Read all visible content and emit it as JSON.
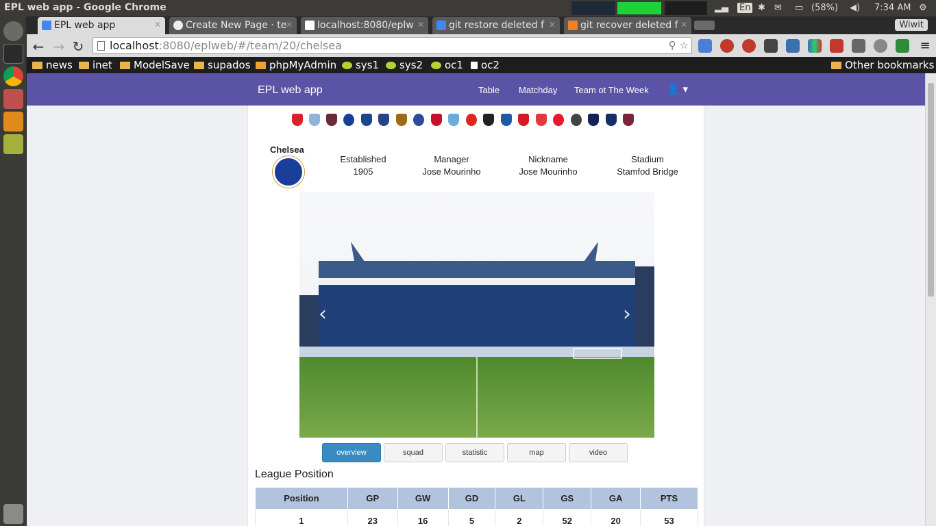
{
  "os": {
    "window_title": "EPL web app - Google Chrome",
    "clock": "7:34 AM",
    "battery": "(58%)",
    "keyboard": "En"
  },
  "browser": {
    "tabs": [
      {
        "label": "EPL web app",
        "icon": "google-icon"
      },
      {
        "label": "Create New Page · te",
        "icon": "github-icon"
      },
      {
        "label": "localhost:8080/eplw",
        "icon": "page-icon"
      },
      {
        "label": "git restore deleted f",
        "icon": "google-icon"
      },
      {
        "label": "git recover deleted f",
        "icon": "stackoverflow-icon"
      }
    ],
    "wiwit": "Wiwit",
    "url_host": "localhost",
    "url_rest": ":8080/eplweb/#/team/20/chelsea",
    "bookmarks": [
      "news",
      "inet",
      "ModelSave",
      "supados",
      "phpMyAdmin",
      "sys1",
      "sys2",
      "oc1",
      "oc2"
    ],
    "other_bookmarks": "Other bookmarks"
  },
  "app": {
    "brand": "EPL web app",
    "nav": [
      "Table",
      "Matchday",
      "Team ot The Week"
    ],
    "team": {
      "name": "Chelsea",
      "fields": [
        {
          "label": "Established",
          "value": "1905"
        },
        {
          "label": "Manager",
          "value": "Jose Mourinho"
        },
        {
          "label": "Nickname",
          "value": "Jose Mourinho"
        },
        {
          "label": "Stadium",
          "value": "Stamfod Bridge"
        }
      ]
    },
    "tabs": [
      "overview",
      "squad",
      "statistic",
      "map",
      "video"
    ],
    "active_tab": "overview",
    "league_position": {
      "title": "League Position",
      "headers": [
        "Position",
        "GP",
        "GW",
        "GD",
        "GL",
        "GS",
        "GA",
        "PTS"
      ],
      "row": [
        "1",
        "23",
        "16",
        "5",
        "2",
        "52",
        "20",
        "53"
      ]
    }
  },
  "colors": {
    "navbar": "#5a53a6",
    "active_tab": "#3a8ac4",
    "table_header": "#b1c3dd"
  }
}
